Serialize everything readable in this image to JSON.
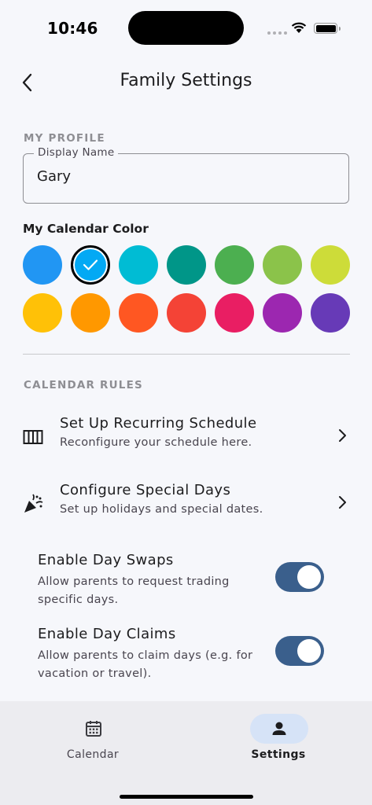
{
  "status_bar": {
    "time": "10:46"
  },
  "header": {
    "title": "Family Settings",
    "back_icon": "chevron-left-icon"
  },
  "profile": {
    "section_label": "MY PROFILE",
    "display_name_label": "Display Name",
    "display_name_value": "Gary",
    "calendar_color_label": "My Calendar Color",
    "colors": [
      "#2196f3",
      "#03a9f4",
      "#00bcd4",
      "#009688",
      "#4caf50",
      "#8bc34a",
      "#cddc39",
      "#ffc107",
      "#ff9800",
      "#ff5722",
      "#f44336",
      "#e91e63",
      "#9c27b0",
      "#673ab7"
    ],
    "selected_color_index": 1
  },
  "calendar_rules": {
    "section_label": "CALENDAR RULES",
    "recurring": {
      "title": "Set Up Recurring Schedule",
      "subtitle": "Reconfigure your schedule here.",
      "icon": "calendar-view-week-icon"
    },
    "special_days": {
      "title": "Configure Special Days",
      "subtitle": "Set up holidays and special dates.",
      "icon": "celebration-icon"
    },
    "day_swaps": {
      "title": "Enable Day Swaps",
      "subtitle": "Allow parents to request trading specific days.",
      "enabled": true
    },
    "day_claims": {
      "title": "Enable Day Claims",
      "subtitle": "Allow parents to claim days (e.g. for vacation or travel).",
      "enabled": true
    }
  },
  "tab_bar": {
    "tabs": [
      {
        "label": "Calendar",
        "icon": "calendar-icon",
        "active": false
      },
      {
        "label": "Settings",
        "icon": "person-icon",
        "active": true
      }
    ]
  }
}
